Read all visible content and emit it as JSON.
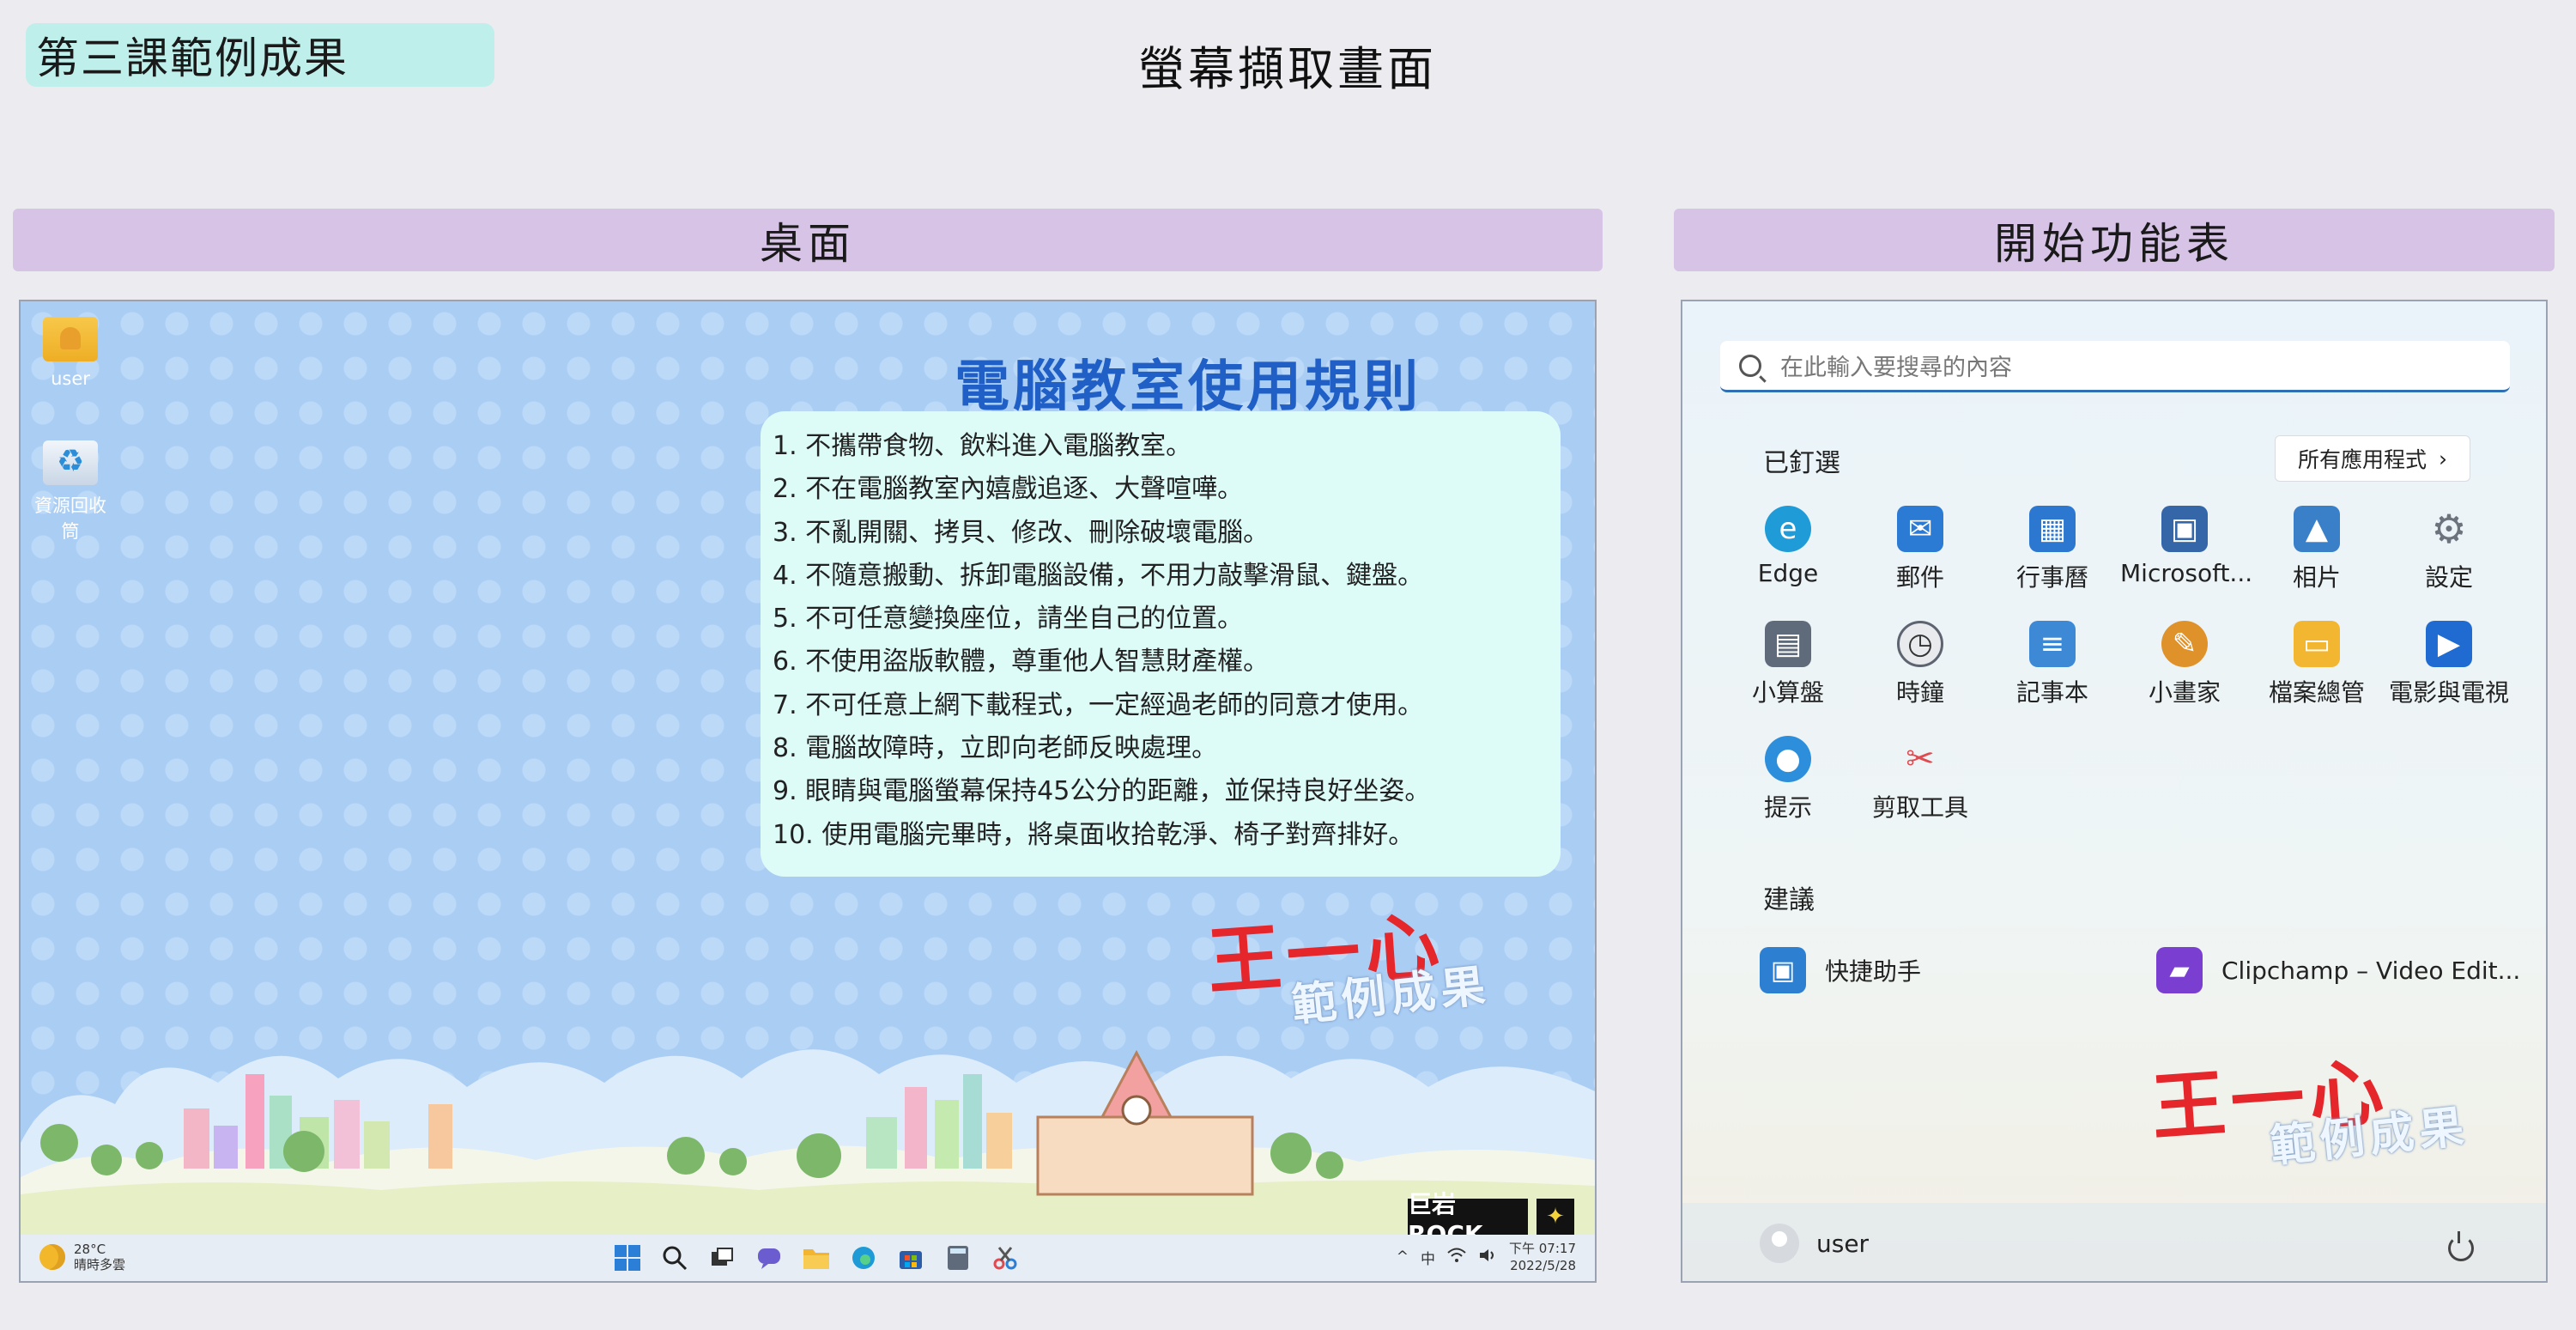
{
  "lesson_badge": "第三課範例成果",
  "header_title": "螢幕擷取畫面",
  "sections": {
    "desktop": "桌面",
    "start": "開始功能表"
  },
  "desktop": {
    "icons": [
      {
        "label": "user"
      },
      {
        "label": "資源回收筒"
      }
    ],
    "rules_title": "電腦教室使用規則",
    "rules": [
      "1. 不攜帶食物、飲料進入電腦教室。",
      "2. 不在電腦教室內嬉戲追逐、大聲喧嘩。",
      "3. 不亂開關、拷貝、修改、刪除破壞電腦。",
      "4. 不隨意搬動、拆卸電腦設備，不用力敲擊滑鼠、鍵盤。",
      "5. 不可任意變換座位，請坐自己的位置。",
      "6. 不使用盜版軟體，尊重他人智慧財產權。",
      "7. 不可任意上網下載程式，一定經過老師的同意才使用。",
      "8. 電腦故障時，立即向老師反映處理。",
      "9. 眼睛與電腦螢幕保持45公分的距離，並保持良好坐姿。",
      "10. 使用電腦完畢時，將桌面收拾乾淨、椅子對齊排好。"
    ],
    "signature_name": "王一心",
    "signature_sub": "範例成果",
    "logo_text": "巨岩ROCK",
    "weather_temp": "28°C",
    "weather_desc": "晴時多雲",
    "tray_chevron": "^",
    "tray_lang": "中",
    "clock_time": "下午 07:17",
    "clock_date": "2022/5/28",
    "colors": {
      "rules_title": "#1f5fc6",
      "signature": "#e5262b",
      "rules_box": "#ddfbf7"
    }
  },
  "start_menu": {
    "search_placeholder": "在此輸入要搜尋的內容",
    "pinned_label": "已釘選",
    "all_apps": "所有應用程式",
    "all_apps_chevron": "›",
    "pinned": [
      {
        "name": "Edge",
        "icon": "edge-icon",
        "color": "#1f9bd8"
      },
      {
        "name": "郵件",
        "icon": "mail-icon",
        "color": "#2b7bd4"
      },
      {
        "name": "行事曆",
        "icon": "calendar-icon",
        "color": "#2c78d0"
      },
      {
        "name": "Microsoft...",
        "icon": "store-icon",
        "color": "#3466a8"
      },
      {
        "name": "相片",
        "icon": "photos-icon",
        "color": "#3a80c8"
      },
      {
        "name": "設定",
        "icon": "gear-icon",
        "color": "#7b8088"
      },
      {
        "name": "小算盤",
        "icon": "calculator-icon",
        "color": "#5f6b7a"
      },
      {
        "name": "時鐘",
        "icon": "clock-icon",
        "color": "#5d6470"
      },
      {
        "name": "記事本",
        "icon": "notepad-icon",
        "color": "#3d89d6"
      },
      {
        "name": "小畫家",
        "icon": "paint-icon",
        "color": "#e0922a"
      },
      {
        "name": "檔案總管",
        "icon": "folder-icon",
        "color": "#f2b630"
      },
      {
        "name": "電影與電視",
        "icon": "movies-icon",
        "color": "#1f6bd1"
      },
      {
        "name": "提示",
        "icon": "tips-icon",
        "color": "#2d8fdb"
      },
      {
        "name": "剪取工具",
        "icon": "snipping-tool-icon",
        "color": "#e04a50"
      }
    ],
    "recommended_label": "建議",
    "recommended": [
      {
        "name": "快捷助手",
        "icon": "quick-assist-icon",
        "color": "#2d7fd2"
      },
      {
        "name": "Clipchamp – Video Edit...",
        "icon": "clipchamp-icon",
        "color": "#7a3fd0"
      }
    ],
    "signature_name": "王一心",
    "signature_sub": "範例成果",
    "user_name": "user"
  }
}
